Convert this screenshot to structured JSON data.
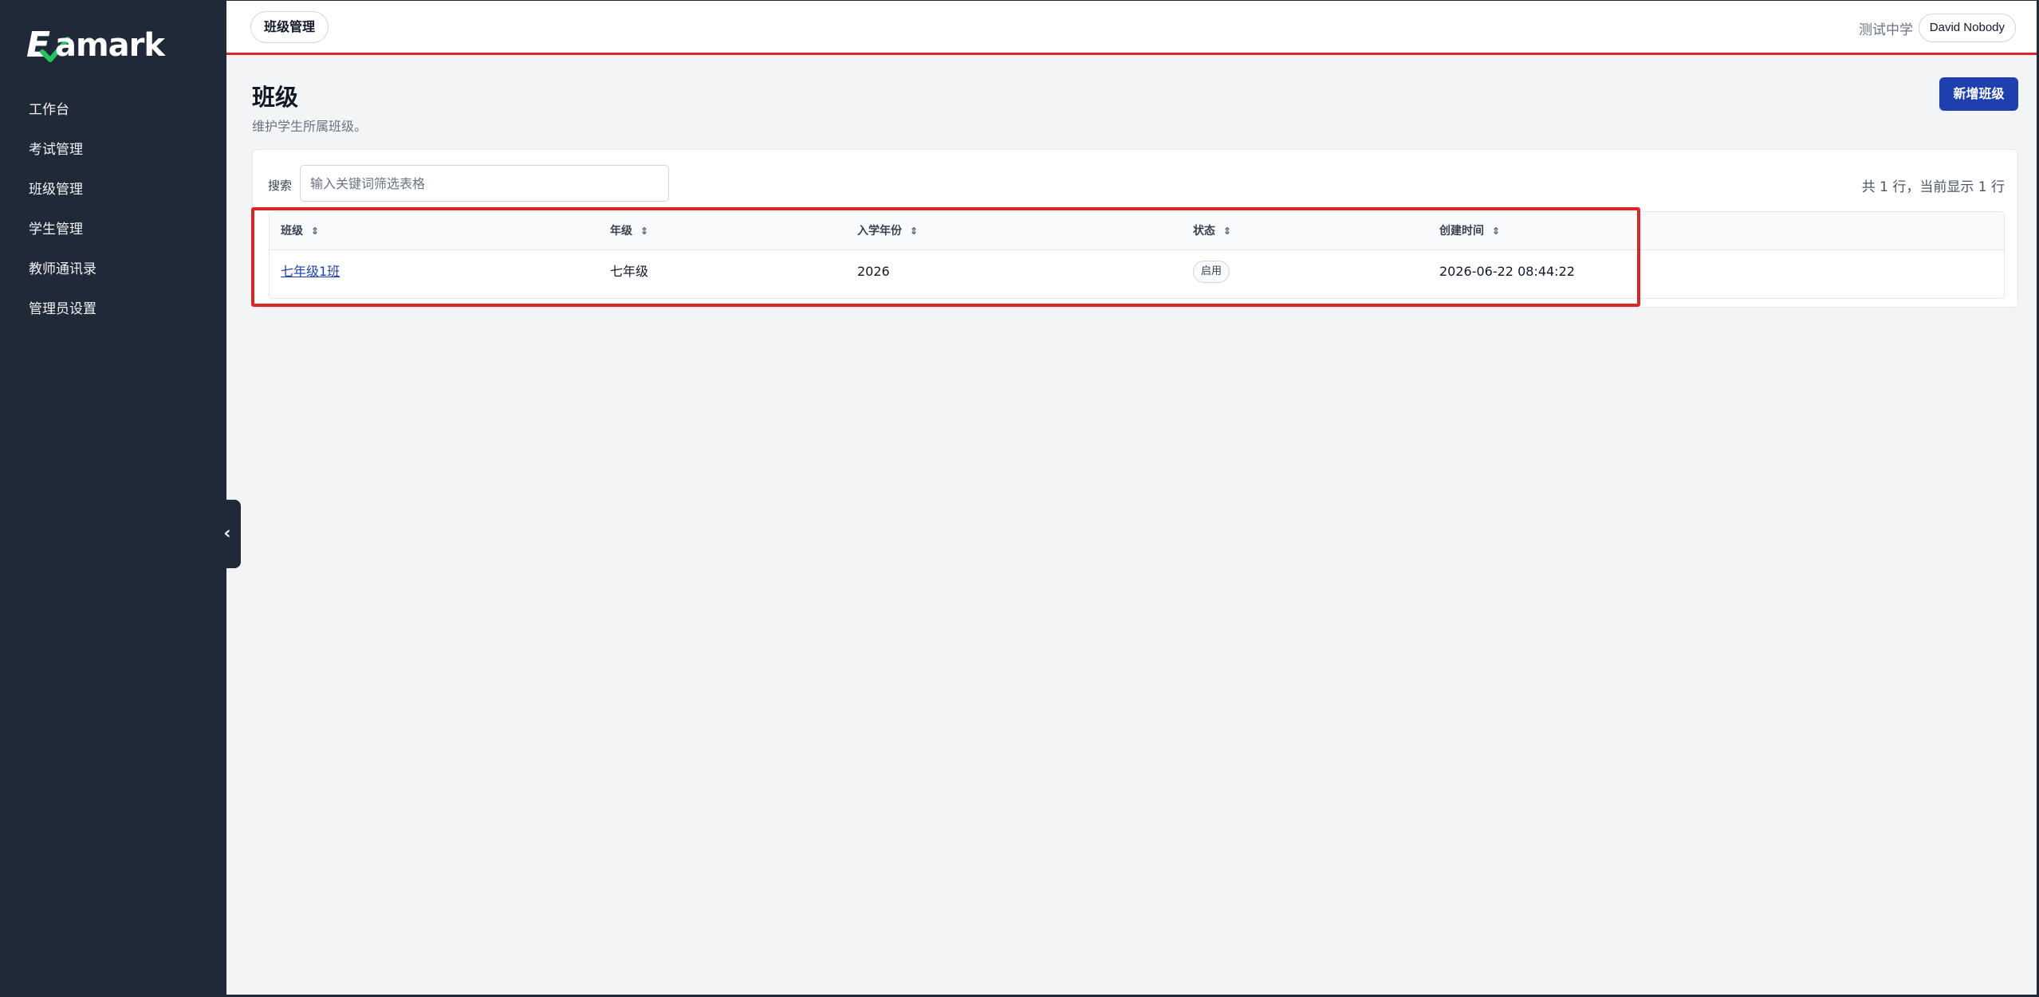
{
  "app": {
    "logo_text": "Examark",
    "logo_e": "E",
    "logo_rest": "amark"
  },
  "sidebar": {
    "items": [
      {
        "label": "工作台"
      },
      {
        "label": "考试管理"
      },
      {
        "label": "班级管理"
      },
      {
        "label": "学生管理"
      },
      {
        "label": "教师通讯录"
      },
      {
        "label": "管理员设置"
      }
    ],
    "collapse_glyph": "‹"
  },
  "header": {
    "breadcrumb": "班级管理",
    "school": "测试中学",
    "user": "David Nobody"
  },
  "page": {
    "title": "班级",
    "subtitle": "维护学生所属班级。",
    "add_button": "新增班级"
  },
  "search": {
    "label": "搜索",
    "placeholder": "输入关键词筛选表格",
    "value": ""
  },
  "summary": "共 1 行，当前显示 1 行",
  "table": {
    "sort_glyph": "⇕",
    "columns": [
      "班级",
      "年级",
      "入学年份",
      "状态",
      "创建时间"
    ],
    "rows": [
      {
        "class": "七年级1班",
        "grade": "七年级",
        "year": "2026",
        "status": "启用",
        "created": "2026-06-22 08:44:22"
      }
    ]
  },
  "colors": {
    "sidebar_bg": "#1f2937",
    "accent": "#1e40af",
    "highlight": "#dc2626",
    "logo_check": "#22c55e"
  }
}
